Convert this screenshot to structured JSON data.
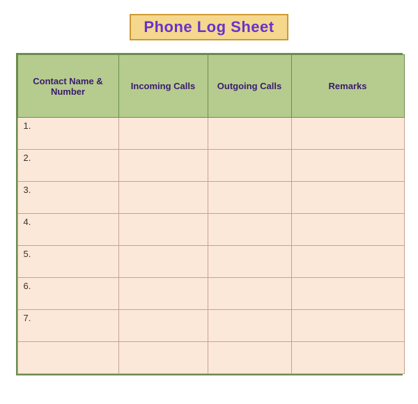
{
  "title": "Phone Log Sheet",
  "table": {
    "headers": [
      "Contact Name &\nNumber",
      "Incoming Calls",
      "Outgoing Calls",
      "Remarks"
    ],
    "rows": [
      {
        "label": "1."
      },
      {
        "label": "2."
      },
      {
        "label": "3."
      },
      {
        "label": "4."
      },
      {
        "label": "5."
      },
      {
        "label": "6."
      },
      {
        "label": "7."
      },
      {
        "label": ""
      }
    ]
  }
}
